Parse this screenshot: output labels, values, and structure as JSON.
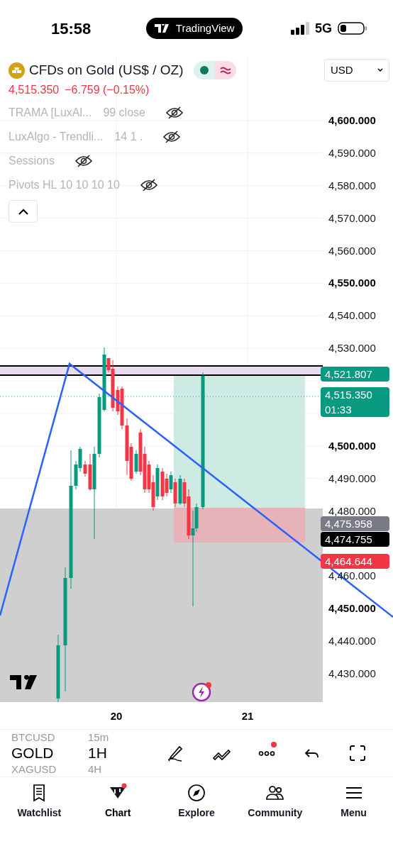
{
  "status_bar": {
    "time": "15:58",
    "app_pill": "TradingView",
    "network": "5G"
  },
  "symbol": {
    "title": "CFDs on Gold (US$ / OZ)",
    "price": "4,515.350",
    "change": "−6.759 (−0.15%)",
    "market_open": true
  },
  "currency": "USD",
  "indicators": [
    {
      "name": "TRAMA [LuxAl...",
      "params": "99 close",
      "hidden": true
    },
    {
      "name": "LuxAlgo - Trendli...",
      "params": "14 1 .",
      "hidden": true
    },
    {
      "name": "Sessions",
      "hidden": true
    },
    {
      "name": "Pivots HL 10 10 10 10",
      "hidden": true
    }
  ],
  "legend_expanded": true,
  "price_axis": [
    {
      "label": "4,600.000",
      "major": true
    },
    {
      "label": "4,590.000",
      "major": false
    },
    {
      "label": "4,580.000",
      "major": false
    },
    {
      "label": "4,570.000",
      "major": false
    },
    {
      "label": "4,560.000",
      "major": false
    },
    {
      "label": "4,550.000",
      "major": true
    },
    {
      "label": "4,540.000",
      "major": false
    },
    {
      "label": "4,530.000",
      "major": false
    },
    {
      "label": "4,500.000",
      "major": true
    },
    {
      "label": "4,490.000",
      "major": false
    },
    {
      "label": "4,480.000",
      "major": false
    },
    {
      "label": "4,460.000",
      "major": false
    },
    {
      "label": "4,450.000",
      "major": true
    },
    {
      "label": "4,440.000",
      "major": false
    },
    {
      "label": "4,430.000",
      "major": false
    }
  ],
  "price_tags": [
    {
      "kind": "target",
      "label": "4,521.807"
    },
    {
      "kind": "last",
      "label": "4,515.350",
      "countdown": "01:33"
    },
    {
      "kind": "alert",
      "label": "4,475.958"
    },
    {
      "kind": "entry",
      "label": "4,474.755"
    },
    {
      "kind": "stop",
      "label": "4,464.644"
    }
  ],
  "time_axis": [
    "20",
    "21"
  ],
  "symbols": [
    {
      "label": "BTCUSD",
      "selected": false
    },
    {
      "label": "GOLD",
      "selected": true
    },
    {
      "label": "XAGUSD",
      "selected": false
    }
  ],
  "intervals": [
    {
      "label": "15m",
      "selected": false
    },
    {
      "label": "1H",
      "selected": true
    },
    {
      "label": "4H",
      "selected": false
    }
  ],
  "toolbar": [
    {
      "kind": "draw",
      "badge": false
    },
    {
      "kind": "patterns",
      "badge": false
    },
    {
      "kind": "more",
      "badge": true
    },
    {
      "kind": "undo",
      "badge": false
    },
    {
      "kind": "fullscreen",
      "badge": false
    }
  ],
  "tabs": [
    {
      "label": "Watchlist",
      "kind": "watchlist",
      "selected": false
    },
    {
      "label": "Chart",
      "kind": "chart",
      "selected": true
    },
    {
      "label": "Explore",
      "kind": "explore",
      "selected": false
    },
    {
      "label": "Community",
      "kind": "community",
      "selected": false
    },
    {
      "label": "Menu",
      "kind": "menu",
      "selected": false
    }
  ]
}
